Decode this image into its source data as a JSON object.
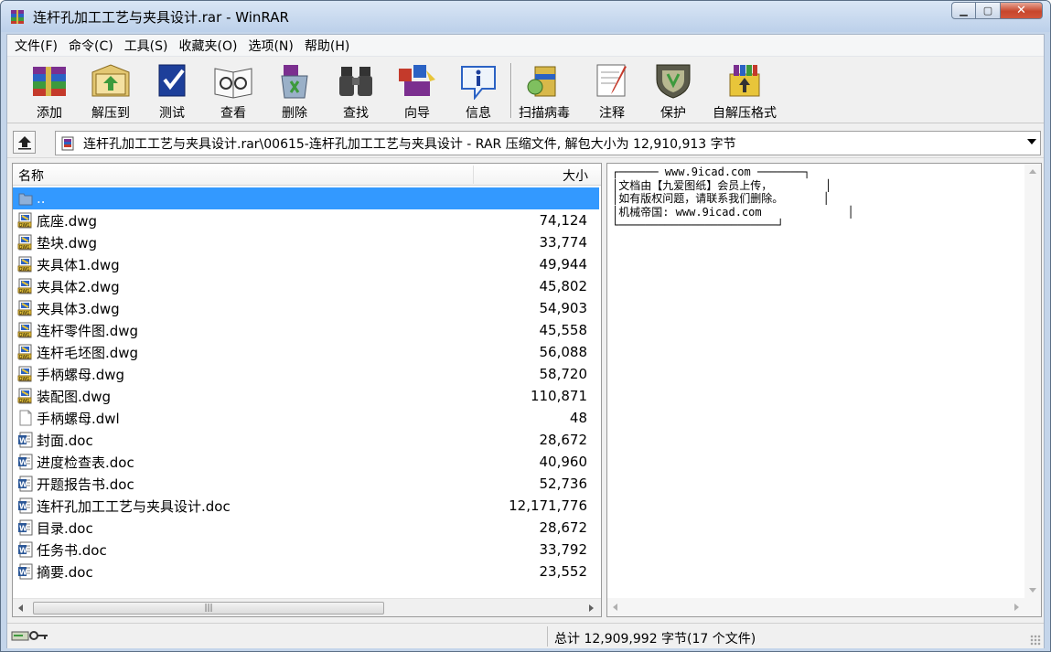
{
  "window": {
    "title": "连杆孔加工工艺与夹具设计.rar - WinRAR",
    "icon": "winrar-books-icon"
  },
  "menu": [
    {
      "label": "文件(F)"
    },
    {
      "label": "命令(C)"
    },
    {
      "label": "工具(S)"
    },
    {
      "label": "收藏夹(O)"
    },
    {
      "label": "选项(N)"
    },
    {
      "label": "帮助(H)"
    }
  ],
  "toolbar": [
    {
      "label": "添加",
      "icon": "add-archive-icon"
    },
    {
      "label": "解压到",
      "icon": "extract-to-icon"
    },
    {
      "label": "测试",
      "icon": "test-icon"
    },
    {
      "label": "查看",
      "icon": "view-icon"
    },
    {
      "label": "删除",
      "icon": "delete-icon"
    },
    {
      "label": "查找",
      "icon": "find-icon"
    },
    {
      "label": "向导",
      "icon": "wizard-icon"
    },
    {
      "label": "信息",
      "icon": "info-icon"
    },
    {
      "label": "扫描病毒",
      "icon": "virus-scan-icon"
    },
    {
      "label": "注释",
      "icon": "comment-icon"
    },
    {
      "label": "保护",
      "icon": "protect-icon"
    },
    {
      "label": "自解压格式",
      "icon": "sfx-icon"
    }
  ],
  "address": {
    "path": "连杆孔加工工艺与夹具设计.rar\\00615-连杆孔加工工艺与夹具设计 - RAR 压缩文件, 解包大小为 12,910,913 字节"
  },
  "columns": {
    "name": "名称",
    "size": "大小"
  },
  "files": [
    {
      "name": "..",
      "size": "",
      "type": "parent",
      "selected": true
    },
    {
      "name": "底座.dwg",
      "size": "74,124",
      "type": "dwg"
    },
    {
      "name": "垫块.dwg",
      "size": "33,774",
      "type": "dwg"
    },
    {
      "name": "夹具体1.dwg",
      "size": "49,944",
      "type": "dwg"
    },
    {
      "name": "夹具体2.dwg",
      "size": "45,802",
      "type": "dwg"
    },
    {
      "name": "夹具体3.dwg",
      "size": "54,903",
      "type": "dwg"
    },
    {
      "name": "连杆零件图.dwg",
      "size": "45,558",
      "type": "dwg"
    },
    {
      "name": "连杆毛坯图.dwg",
      "size": "56,088",
      "type": "dwg"
    },
    {
      "name": "手柄螺母.dwg",
      "size": "58,720",
      "type": "dwg"
    },
    {
      "name": "装配图.dwg",
      "size": "110,871",
      "type": "dwg"
    },
    {
      "name": "手柄螺母.dwl",
      "size": "48",
      "type": "blank"
    },
    {
      "name": "封面.doc",
      "size": "28,672",
      "type": "doc"
    },
    {
      "name": "进度检查表.doc",
      "size": "40,960",
      "type": "doc"
    },
    {
      "name": "开题报告书.doc",
      "size": "52,736",
      "type": "doc"
    },
    {
      "name": "连杆孔加工工艺与夹具设计.doc",
      "size": "12,171,776",
      "type": "doc"
    },
    {
      "name": "目录.doc",
      "size": "28,672",
      "type": "doc"
    },
    {
      "name": "任务书.doc",
      "size": "33,792",
      "type": "doc"
    },
    {
      "name": "摘要.doc",
      "size": "23,552",
      "type": "doc"
    }
  ],
  "comment": {
    "text": "┌────── www.9icad.com ───────┐\n│文档由【九爱图纸】会员上传，        │\n│如有版权问题，请联系我们删除。      │\n│机械帝国: www.9icad.com             │\n└────────────────────────┘"
  },
  "status": {
    "total": "总计 12,909,992 字节(17 个文件)"
  },
  "colors": {
    "selection": "#3399ff",
    "title_bar": "#c4d5ea",
    "close_button": "#c7462c"
  }
}
